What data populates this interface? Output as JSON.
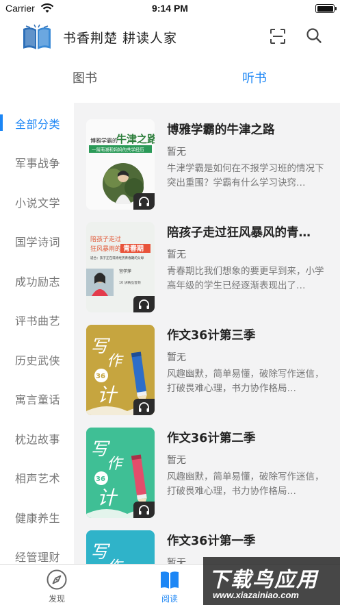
{
  "status_bar": {
    "carrier": "Carrier",
    "time": "9:14 PM"
  },
  "header": {
    "title": "书香荆楚 耕读人家"
  },
  "tabs": [
    {
      "label": "图书",
      "active": false
    },
    {
      "label": "听书",
      "active": true
    }
  ],
  "sidebar": {
    "categories": [
      {
        "label": "全部分类",
        "active": true
      },
      {
        "label": "军事战争"
      },
      {
        "label": "小说文学"
      },
      {
        "label": "国学诗词"
      },
      {
        "label": "成功励志"
      },
      {
        "label": "评书曲艺"
      },
      {
        "label": "历史武侠"
      },
      {
        "label": "寓言童话"
      },
      {
        "label": "枕边故事"
      },
      {
        "label": "相声艺术"
      },
      {
        "label": "健康养生"
      },
      {
        "label": "经管理财"
      }
    ]
  },
  "books": [
    {
      "title": "博雅学霸的牛津之路",
      "author": "暂无",
      "description": "牛津学霸是如何在不报学习班的情况下突出重围？学霸有什么学习诀窍…",
      "cover": {
        "line1": "博雅学霸的",
        "line2": "牛津之路",
        "subtitle": "—留南湖和妈妈的共学经历"
      }
    },
    {
      "title": "陪孩子走过狂风暴风的青…",
      "author": "暂无",
      "description": "青春期比我们想象的要更早到来，小学高年级的学生已经逐渐表现出了…",
      "cover": {
        "line1": "陪孩子走过",
        "line2": "狂风暴雨的",
        "line3": "青春期",
        "subtitle": "适合：孩子正在或将经历青春期的父母",
        "author_label": "宫学萍",
        "episodes": "16 讲精品音频"
      }
    },
    {
      "title": "作文36计第三季",
      "author": "暂无",
      "description": "风趣幽默，简单易懂，破除写作迷信，打破畏难心理，书力协作格局…",
      "cover": {
        "text1": "写",
        "text2": "作",
        "num": "36",
        "text3": "计"
      }
    },
    {
      "title": "作文36计第二季",
      "author": "暂无",
      "description": "风趣幽默，简单易懂，破除写作迷信，打破畏难心理，书力协作格局…",
      "cover": {
        "text1": "写",
        "text2": "作",
        "num": "36",
        "text3": "计"
      }
    },
    {
      "title": "作文36计第一季",
      "author": "暂无",
      "description": "",
      "cover": {
        "text1": "写",
        "text2": "作"
      }
    }
  ],
  "bottom_nav": [
    {
      "label": "发现",
      "icon": "compass-icon",
      "active": false
    },
    {
      "label": "阅读",
      "icon": "book-icon",
      "active": true
    }
  ],
  "watermark": {
    "big": "下载鸟应用",
    "small": "www.xiazainiao.com"
  },
  "colors": {
    "accent": "#1c86f5",
    "content_bg": "#f3f3f4"
  }
}
